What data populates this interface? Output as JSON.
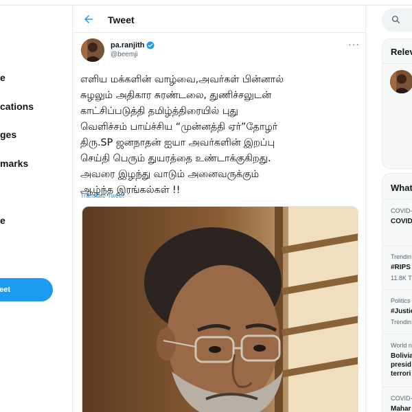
{
  "nav": {
    "items": [
      {
        "label": "e"
      },
      {
        "label": "cations"
      },
      {
        "label": "ges"
      },
      {
        "label": "marks"
      },
      {
        "label": "e"
      }
    ],
    "tweet_button": "eet"
  },
  "header": {
    "title": "Tweet"
  },
  "tweet": {
    "author_name": "pa.ranjith",
    "author_handle": "@beemji",
    "text": "எளிய மக்களின் வாழ்வை,அவர்கள் பின்னால்\nசுழலும் அதிகார சுரண்டலை, துணிச்சலுடன்\nகாட்சிப்படுத்தி தமிழ்த்திரையில் புது\nவெளிச்சம் பாய்ச்சிய “முன்னத்தி ஏர்”தோழர்\nதிரு.SP ஜனநாதன் ஐயா அவர்களின் இறப்பு\nசெய்தி பெரும் துயரத்தை உண்டாக்குகிறது.\nஅவரை இழந்து வாடும் அனைவருக்கும்\nஆழ்ந்த இரங்கல்கள் !!",
    "translate_label": "Translate Tweet"
  },
  "right": {
    "search_icon": "search-icon",
    "relevant_title": "Relev",
    "trends_title": "What",
    "trends": [
      {
        "small": "COVID-",
        "big": "COVID"
      },
      {
        "small": "Trendin",
        "big": "#RIPS",
        "extra": "11.8K T"
      },
      {
        "small": "Politics",
        "big": "#Justic",
        "extra": "Trendin"
      },
      {
        "small": "World n",
        "big": "Bolivia\npresid\nterrori"
      },
      {
        "small": "COVID-",
        "big": "Mahar"
      }
    ]
  },
  "colors": {
    "accent": "#1d9bf0",
    "text": "#0f1419",
    "muted": "#536471"
  }
}
